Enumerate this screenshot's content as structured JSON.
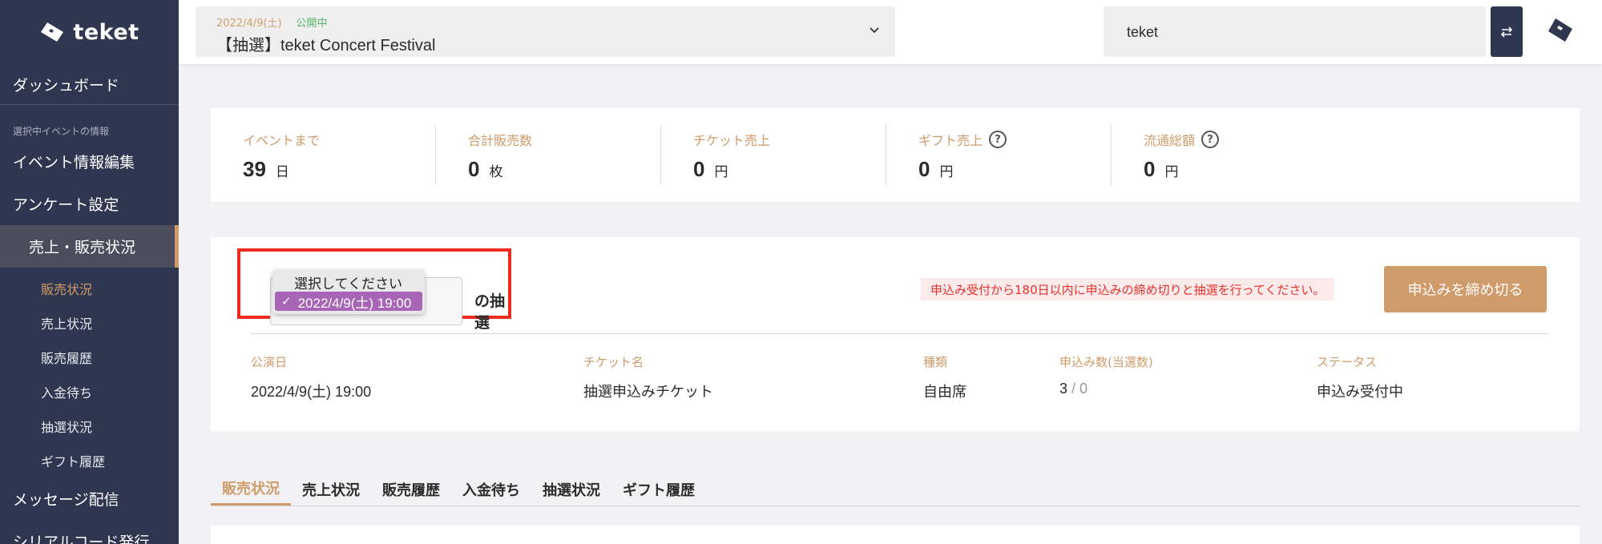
{
  "sidebar": {
    "logo_text": "teket",
    "dashboard": "ダッシュボード",
    "section_label": "選択中イベントの情報",
    "items": [
      {
        "label": "イベント情報編集"
      },
      {
        "label": "アンケート設定"
      },
      {
        "label": "売上・販売状況"
      }
    ],
    "sub_items": [
      {
        "label": "販売状況"
      },
      {
        "label": "売上状況"
      },
      {
        "label": "販売履歴"
      },
      {
        "label": "入金待ち"
      },
      {
        "label": "抽選状況"
      },
      {
        "label": "ギフト履歴"
      }
    ],
    "more_items": [
      {
        "label": "メッセージ配信"
      },
      {
        "label": "シリアルコード発行"
      }
    ]
  },
  "topbar": {
    "event_date": "2022/4/9(土)",
    "event_status": "公開中",
    "event_title": "【抽選】teket Concert Festival",
    "org_name": "teket"
  },
  "stats": [
    {
      "label": "イベントまで",
      "value": "39",
      "unit": "日"
    },
    {
      "label": "合計販売数",
      "value": "0",
      "unit": "枚"
    },
    {
      "label": "チケット売上",
      "value": "0",
      "unit": "円"
    },
    {
      "label": "ギフト売上",
      "value": "0",
      "unit": "円"
    },
    {
      "label": "流通総額",
      "value": "0",
      "unit": "円"
    }
  ],
  "lottery": {
    "dropdown_options": [
      "選択してください",
      "2022/4/9(土) 19:00"
    ],
    "suffix": "の抽選",
    "warning": "申込み受付から180日以内に申込みの締め切りと抽選を行ってください。",
    "close_button": "申込みを締め切る",
    "headers": {
      "date": "公演日",
      "ticket": "チケット名",
      "type": "種類",
      "count": "申込み数(当選数)",
      "status": "ステータス"
    },
    "row": {
      "date": "2022/4/9(土) 19:00",
      "ticket": "抽選申込みチケット",
      "type": "自由席",
      "applied": "3",
      "sep": " / ",
      "won": "0",
      "status": "申込み受付中"
    }
  },
  "tabs": [
    {
      "label": "販売状況"
    },
    {
      "label": "売上状況"
    },
    {
      "label": "販売履歴"
    },
    {
      "label": "入金待ち"
    },
    {
      "label": "抽選状況"
    },
    {
      "label": "ギフト履歴"
    }
  ],
  "colors": {
    "sidebar": "#2e3650",
    "accent": "#d09b6b",
    "highlight": "#ee2a1e",
    "selected_option": "#a865b5"
  }
}
